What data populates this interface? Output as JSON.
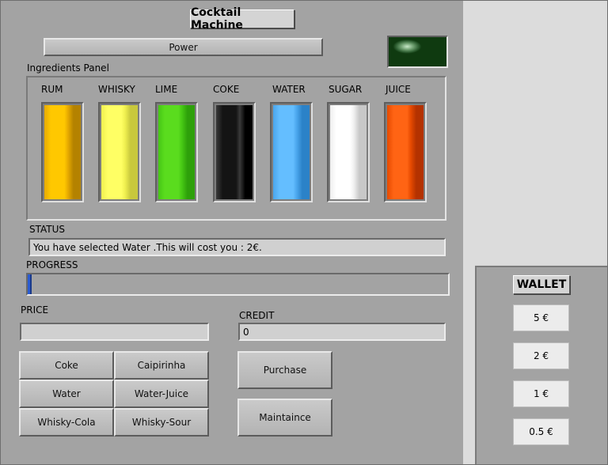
{
  "app": {
    "title": "Cocktail Machine"
  },
  "power": {
    "label": "Power",
    "led_on": true
  },
  "ingredients": {
    "panel_label": "Ingredients Panel",
    "items": [
      {
        "name": "RUM",
        "colors": [
          "#ffc800",
          "#e6aa00",
          "#b48200"
        ]
      },
      {
        "name": "WHISKY",
        "colors": [
          "#ffff64",
          "#f0f050",
          "#c8c83c"
        ]
      },
      {
        "name": "LIME",
        "colors": [
          "#5adc1e",
          "#46c814",
          "#2ea00a"
        ]
      },
      {
        "name": "COKE",
        "colors": [
          "#141414",
          "#3a3a3a",
          "#000000"
        ]
      },
      {
        "name": "WATER",
        "colors": [
          "#64beff",
          "#4aa6ec",
          "#2b82c8"
        ]
      },
      {
        "name": "SUGAR",
        "colors": [
          "#ffffff",
          "#f0f0f0",
          "#c8c8c8"
        ]
      },
      {
        "name": "JUICE",
        "colors": [
          "#ff6414",
          "#e64a00",
          "#b43200"
        ]
      }
    ]
  },
  "status": {
    "label": "STATUS",
    "text": "You have selected Water .This will cost you : 2€."
  },
  "progress": {
    "label": "PROGRESS",
    "value": 0.01
  },
  "price": {
    "label": "PRICE",
    "value": ""
  },
  "credit": {
    "label": "CREDIT",
    "value": "0"
  },
  "drinks": [
    "Coke",
    "Caipirinha",
    "Water",
    "Water-Juice",
    "Whisky-Cola",
    "Whisky-Sour"
  ],
  "actions": {
    "purchase": "Purchase",
    "maintenance": "Maintaince"
  },
  "wallet": {
    "title": "WALLET",
    "coins": [
      "5 €",
      "2 €",
      "1 €",
      "0.5 €"
    ]
  },
  "colors": {
    "panel": "#a3a3a3",
    "progress": "#2a5bd1"
  }
}
